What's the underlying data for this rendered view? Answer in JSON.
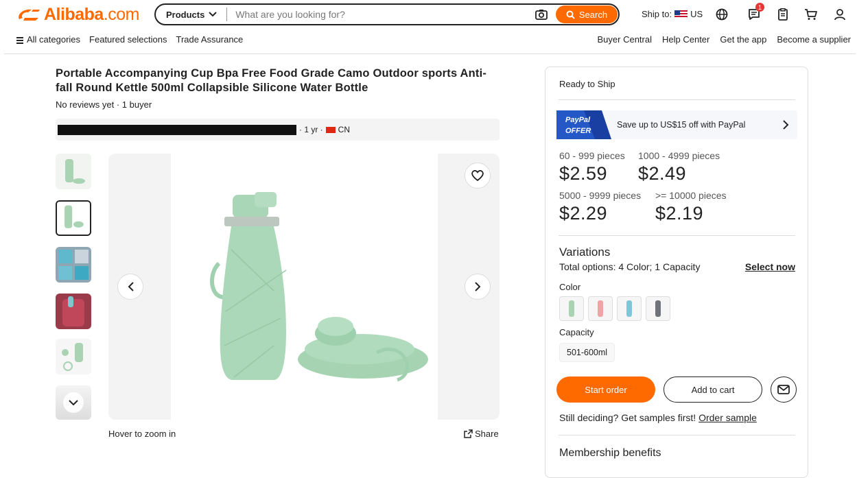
{
  "header": {
    "logo_name": "Alibaba",
    "logo_suffix": ".com",
    "search": {
      "category": "Products",
      "placeholder": "What are you looking for?",
      "button_label": "Search"
    },
    "ship_to_label": "Ship to:",
    "ship_to_country": "US",
    "messages_count": "1"
  },
  "subnav": {
    "left": [
      "All categories",
      "Featured selections",
      "Trade Assurance"
    ],
    "right": [
      "Buyer Central",
      "Help Center",
      "Get the app",
      "Become a supplier"
    ]
  },
  "product": {
    "title": "Portable Accompanying Cup Bpa Free Food Grade Camo Outdoor sports Anti-fall Round Kettle 500ml Collapsible Silicone Water Bottle",
    "reviews": "No reviews yet · 1 buyer",
    "supplier_meta": "· 1 yr ·",
    "supplier_country": "CN",
    "hover_zoom": "Hover to zoom in",
    "share": "Share"
  },
  "panel": {
    "ready_to_ship": "Ready to Ship",
    "paypal": {
      "logo_line1": "PayPal",
      "logo_line2": "OFFER",
      "text": "Save up to US$15 off with PayPal"
    },
    "tiers": [
      {
        "qty": "60 - 999 pieces",
        "price": "$2.59"
      },
      {
        "qty": "1000 - 4999 pieces",
        "price": "$2.49"
      },
      {
        "qty": "5000 - 9999 pieces",
        "price": "$2.29"
      },
      {
        "qty": ">= 10000 pieces",
        "price": "$2.19"
      }
    ],
    "variations": {
      "title": "Variations",
      "summary": "Total options: 4 Color; 1 Capacity",
      "select_now": "Select now",
      "color_label": "Color",
      "capacity_label": "Capacity",
      "capacity_option": "501-600ml"
    },
    "buttons": {
      "start_order": "Start order",
      "add_to_cart": "Add to cart"
    },
    "still_deciding": "Still deciding? Get samples first!",
    "order_sample": "Order sample",
    "membership": "Membership benefits"
  },
  "colors": {
    "brand": "#ff6a00",
    "swatch_green": "#a9d3b2",
    "swatch_pink": "#f2a3a8",
    "swatch_blue": "#7fc6d8",
    "swatch_grey": "#6f7278"
  }
}
